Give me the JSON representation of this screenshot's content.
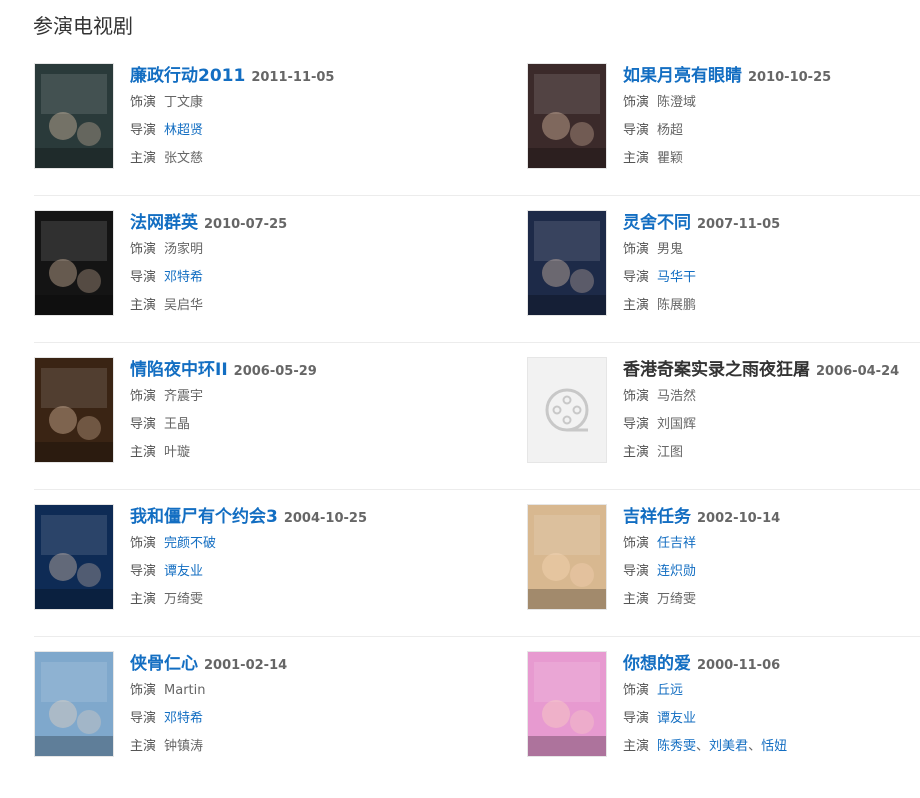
{
  "section": {
    "title": "参演电视剧"
  },
  "labels": {
    "role": "饰演",
    "director": "导演",
    "star": "主演"
  },
  "items": [
    {
      "title": "廉政行动2011",
      "date": "2011-11-05",
      "role": "丁文康",
      "director": "林超贤",
      "director_link": true,
      "star": "张文慈",
      "poster_bg": "#2a3a3a"
    },
    {
      "title": "如果月亮有眼睛",
      "date": "2010-10-25",
      "role": "陈澄域",
      "director": "杨超",
      "director_link": false,
      "star": "瞿颖",
      "poster_bg": "#3b2a2a"
    },
    {
      "title": "法网群英",
      "date": "2010-07-25",
      "role": "汤家明",
      "director": "邓特希",
      "director_link": true,
      "star": "吴启华",
      "poster_bg": "#141414"
    },
    {
      "title": "灵舍不同",
      "date": "2007-11-05",
      "role": "男鬼",
      "director": "马华干",
      "director_link": true,
      "star": "陈展鹏",
      "poster_bg": "#1d2a48"
    },
    {
      "title": "情陷夜中环II",
      "date": "2006-05-29",
      "role": "齐震宇",
      "director": "王晶",
      "director_link": false,
      "star": "叶璇",
      "poster_bg": "#3a2414"
    },
    {
      "title": "香港奇案实录之雨夜狂屠",
      "date": "2006-04-24",
      "role": "马浩然",
      "director": "刘国辉",
      "director_link": false,
      "star": "江图",
      "placeholder": true,
      "poster_bg": "#f2f2f2"
    },
    {
      "title": "我和僵尸有个约会3",
      "date": "2004-10-25",
      "role": "完颜不破",
      "role_link": true,
      "director": "谭友业",
      "director_link": true,
      "star": "万绮雯",
      "poster_bg": "#0e2b55"
    },
    {
      "title": "吉祥任务",
      "date": "2002-10-14",
      "role": "任吉祥",
      "role_link": true,
      "director": "连炽勋",
      "director_link": true,
      "star": "万绮雯",
      "poster_bg": "#d8b890"
    },
    {
      "title": "侠骨仁心",
      "date": "2001-02-14",
      "role": "Martin",
      "director": "邓特希",
      "director_link": true,
      "star": "钟镇涛",
      "poster_bg": "#7fa8cc"
    },
    {
      "title": "你想的爱",
      "date": "2000-11-06",
      "role": "丘远",
      "role_link": true,
      "director": "谭友业",
      "director_link": true,
      "stars": [
        "陈秀雯",
        "刘美君",
        "恬妞"
      ],
      "star_links": true,
      "poster_bg": "#e79ad0"
    }
  ]
}
